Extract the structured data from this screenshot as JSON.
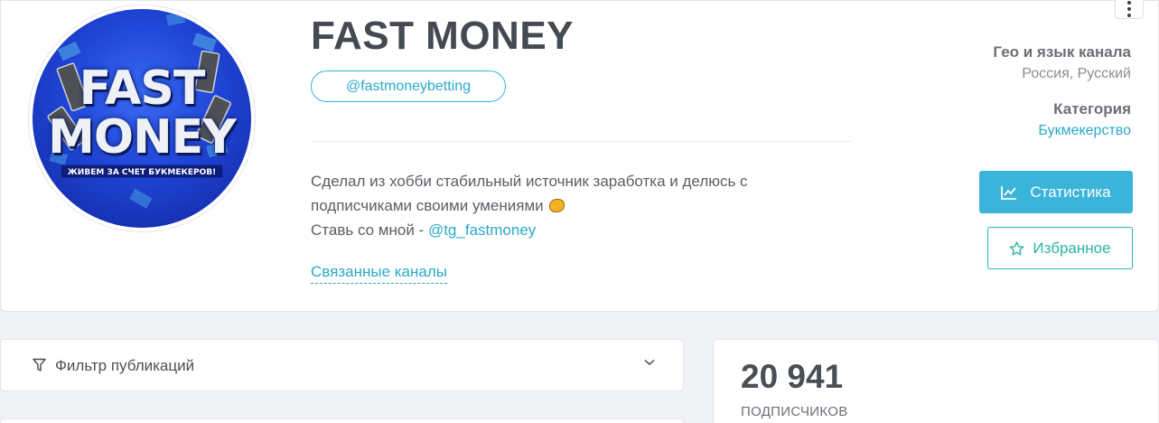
{
  "channel": {
    "name": "FAST MONEY",
    "username": "@fastmoneybetting",
    "avatar": {
      "line1": "FAST",
      "line2": "MONEY",
      "tagline": "ЖИВЕМ ЗА СЧЕТ БУКМЕКЕРОВ!"
    },
    "description": {
      "line1": "Сделал из хобби стабильный источник заработка и делюсь с",
      "line2": "подписчиками своими умениями",
      "line3_prefix": "Ставь со мной - ",
      "line3_link": "@tg_fastmoney"
    },
    "related_label": "Связанные каналы"
  },
  "meta": {
    "geo_label": "Гео и язык канала",
    "geo_value": "Россия, Русский",
    "category_label": "Категория",
    "category_value": "Букмекерство"
  },
  "actions": {
    "stats_label": "Статистика",
    "favorite_label": "Избранное"
  },
  "filter": {
    "label": "Фильтр публикаций"
  },
  "subscribers": {
    "count": "20 941",
    "label": "ПОДПИСЧИКОВ"
  },
  "colors": {
    "accent": "#2aa9cc",
    "stats_button": "#3ab4d9",
    "favorite": "#2cb5a0",
    "title": "#454a52",
    "avatar_blue": "#1f45d6"
  },
  "icons": {
    "menu": "more-vertical-icon",
    "stats": "line-chart-icon",
    "favorite": "star-icon",
    "filter": "filter-icon",
    "chevron": "chevron-down-icon",
    "emoji": "coin-emoji-icon"
  }
}
